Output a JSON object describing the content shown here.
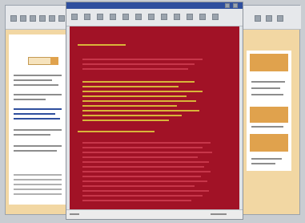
{
  "colors": {
    "desktop": "#c9cdd2",
    "window_chrome": "#dfe2e6",
    "toolbar": "#e6e8eb",
    "page_bg": "#f2d7a3",
    "page_panel": "#ffffff",
    "accent_orange": "#e0a24d",
    "title_blue": "#2f4f9e",
    "document_red": "#a11226",
    "document_text": "#d8b43a",
    "status_bar": "#ececec"
  },
  "icons": {
    "toolbar": [
      "back-icon",
      "forward-icon",
      "stop-icon",
      "refresh-icon",
      "home-icon",
      "search-icon",
      "favorites-icon",
      "history-icon",
      "print-icon",
      "mail-icon",
      "edit-icon",
      "discuss-icon"
    ],
    "window_controls": [
      "minimize-icon",
      "maximize-icon",
      "close-icon"
    ]
  },
  "window": {
    "title": ""
  },
  "left_page": {
    "title": "",
    "button": "",
    "lines": []
  },
  "document": {
    "heading": "",
    "section_heading": ""
  },
  "right_page": {
    "tab_labels": [
      "",
      "",
      ""
    ]
  },
  "status": {
    "left_text": "",
    "right_text": ""
  }
}
